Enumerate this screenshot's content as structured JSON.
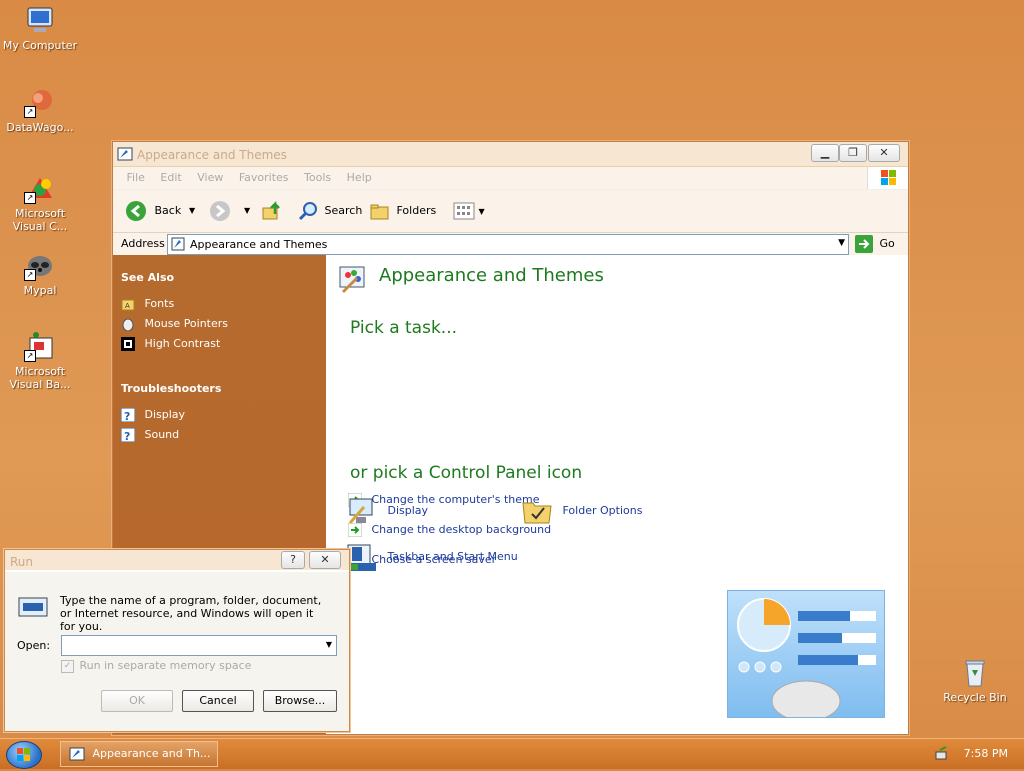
{
  "desktop": {
    "icons": [
      {
        "label": "My Computer"
      },
      {
        "label": "DataWago..."
      },
      {
        "label": "Microsoft Visual C..."
      },
      {
        "label": "Mypal"
      },
      {
        "label": "Microsoft Visual Ba..."
      },
      {
        "label": "Recycle Bin"
      }
    ]
  },
  "window": {
    "title": "Appearance and Themes",
    "menu": [
      "File",
      "Edit",
      "View",
      "Favorites",
      "Tools",
      "Help"
    ],
    "toolbar": {
      "back": "Back",
      "search": "Search",
      "folders": "Folders"
    },
    "address": {
      "label": "Address",
      "value": "Appearance and Themes",
      "go": "Go"
    },
    "left_pane": {
      "see_also": {
        "heading": "See Also",
        "items": [
          "Fonts",
          "Mouse Pointers",
          "High Contrast"
        ]
      },
      "troubleshooters": {
        "heading": "Troubleshooters",
        "items": [
          "Display",
          "Sound"
        ]
      }
    },
    "right_pane": {
      "title": "Appearance and Themes",
      "pick_task": "Pick a task...",
      "tasks": [
        "Change the computer's theme",
        "Change the desktop background",
        "Choose a screen saver"
      ],
      "pick_icon": "or pick a Control Panel icon",
      "icons": [
        "Display",
        "Folder Options",
        "Taskbar and Start Menu"
      ]
    }
  },
  "run_dialog": {
    "title": "Run",
    "description": "Type the name of a program, folder, document, or Internet resource, and Windows will open it for you.",
    "open_label": "Open:",
    "open_value": "",
    "checkbox_label": "Run in separate memory space",
    "checkbox_checked": true,
    "ok": "OK",
    "cancel": "Cancel",
    "browse": "Browse..."
  },
  "taskbar": {
    "task_label": "Appearance and Th...",
    "clock": "7:58 PM"
  },
  "colors": {
    "desktop": "#dc9350",
    "left_pane": "#b56a2e",
    "heading_green": "#1e7a1e",
    "link_blue": "#1d3b9a"
  }
}
